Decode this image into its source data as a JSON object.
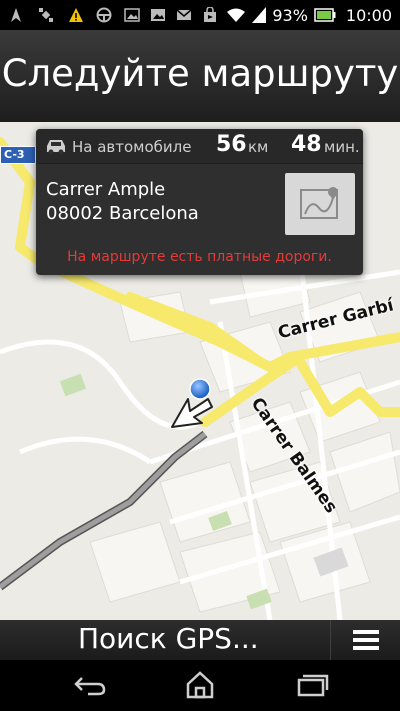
{
  "statusbar": {
    "battery": "93%",
    "time": "10:00"
  },
  "header": {
    "title": "Следуйте маршруту"
  },
  "map": {
    "road_label_1": "C-3",
    "street_1": "Carrer Garbí",
    "street_2": "Carrer Balmes"
  },
  "route_card": {
    "mode_label": "На автомобиле",
    "distance_value": "56",
    "distance_unit": "км",
    "time_value": "48",
    "time_unit": "мин.",
    "address_line1": "Carrer Ample",
    "address_line2": "08002 Barcelona",
    "warning": "На маршруте есть платные дороги."
  },
  "bottombar": {
    "status": "Поиск GPS..."
  },
  "icons": {
    "car": "car-icon",
    "map_preview": "map-icon",
    "menu": "menu-icon",
    "back": "back-icon",
    "home": "home-icon",
    "recents": "recents-icon"
  },
  "colors": {
    "warning_red": "#e23b3b",
    "road_yellow": "#f6e96b",
    "location_blue": "#2e7fe0"
  }
}
